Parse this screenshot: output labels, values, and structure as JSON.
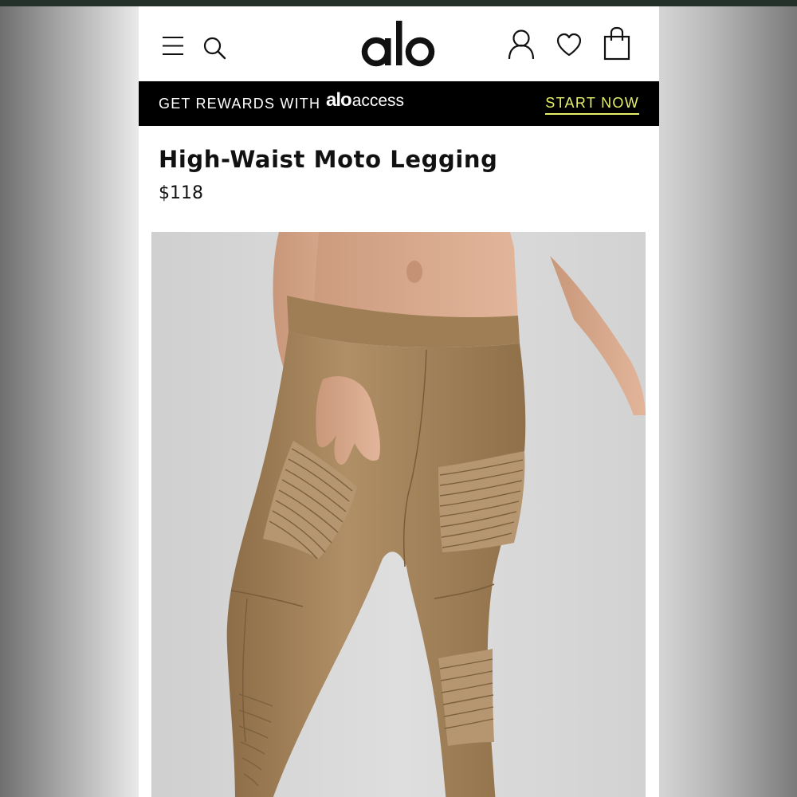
{
  "header": {
    "brand": "alo",
    "icons": [
      "menu-icon",
      "search-icon",
      "account-icon",
      "wishlist-heart-icon",
      "shopping-bag-icon"
    ]
  },
  "promo": {
    "text": "GET REWARDS WITH",
    "brand_bold": "alo",
    "brand_light": "access",
    "cta": "START NOW",
    "cta_color": "#e6f06a"
  },
  "product": {
    "title": "High-Waist Moto Legging",
    "price": "$118"
  },
  "colors": {
    "background_strip": "#24312a",
    "promo_bg": "#000000",
    "legging": "#a4845c",
    "photo_bg": "#d8d8d8"
  }
}
